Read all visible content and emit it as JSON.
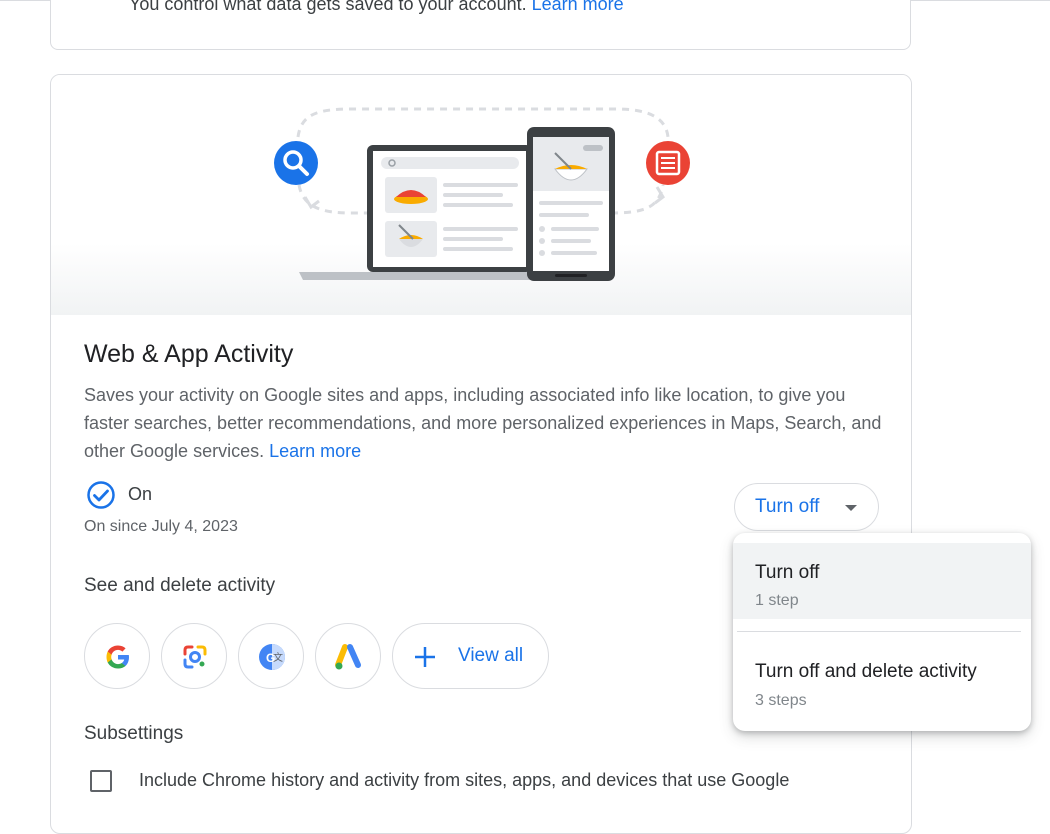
{
  "top_card": {
    "text": "You control what data gets saved to your account.",
    "link": "Learn more"
  },
  "activity": {
    "title": "Web & App Activity",
    "description": "Saves your activity on Google sites and apps, including associated info like location, to give you faster searches, better recommendations, and more personalized experiences in Maps, Search, and other Google services.",
    "learn_more": "Learn more",
    "status": "On",
    "since": "On since July 4, 2023",
    "turn_off_button": "Turn off"
  },
  "see_delete": {
    "heading": "See and delete activity",
    "apps": [
      {
        "icon": "google-search-icon"
      },
      {
        "icon": "google-lens-icon"
      },
      {
        "icon": "google-translate-icon"
      },
      {
        "icon": "google-ads-icon"
      }
    ],
    "view_all": "View all"
  },
  "subsettings": {
    "heading": "Subsettings",
    "chrome_history": "Include Chrome history and activity from sites, apps, and devices that use Google"
  },
  "menu": {
    "items": [
      {
        "label": "Turn off",
        "sub": "1 step"
      },
      {
        "label": "Turn off and delete activity",
        "sub": "3 steps"
      }
    ]
  },
  "colors": {
    "link": "#1a73e8",
    "status_check": "#1a73e8",
    "search_badge": "#1a73e8",
    "doc_badge": "#ea4335"
  }
}
